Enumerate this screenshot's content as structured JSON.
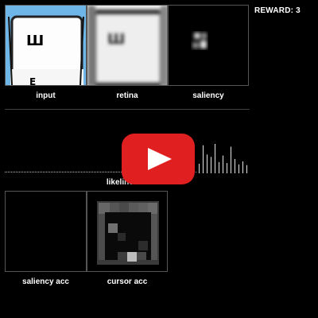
{
  "reward": {
    "text": "REWARD: 3"
  },
  "panels": {
    "input": {
      "label": "input",
      "glyphs": [
        "Ш",
        "E"
      ]
    },
    "retina": {
      "label": "retina",
      "glyphs": [
        "Ш"
      ]
    },
    "saliency": {
      "label": "saliency"
    },
    "saliency_acc": {
      "label": "saliency acc"
    },
    "cursor_acc": {
      "label": "cursor acc"
    }
  },
  "likelihoods": {
    "label": "likelihoods",
    "baseline_value": 0.05,
    "peak_values": [
      0.28,
      0.82,
      0.55,
      0.48,
      0.86,
      0.33,
      0.52,
      0.3,
      0.78,
      0.42,
      0.26,
      0.35,
      0.24
    ]
  },
  "overlay": {
    "icon": "play-icon",
    "color": "#e02020"
  }
}
